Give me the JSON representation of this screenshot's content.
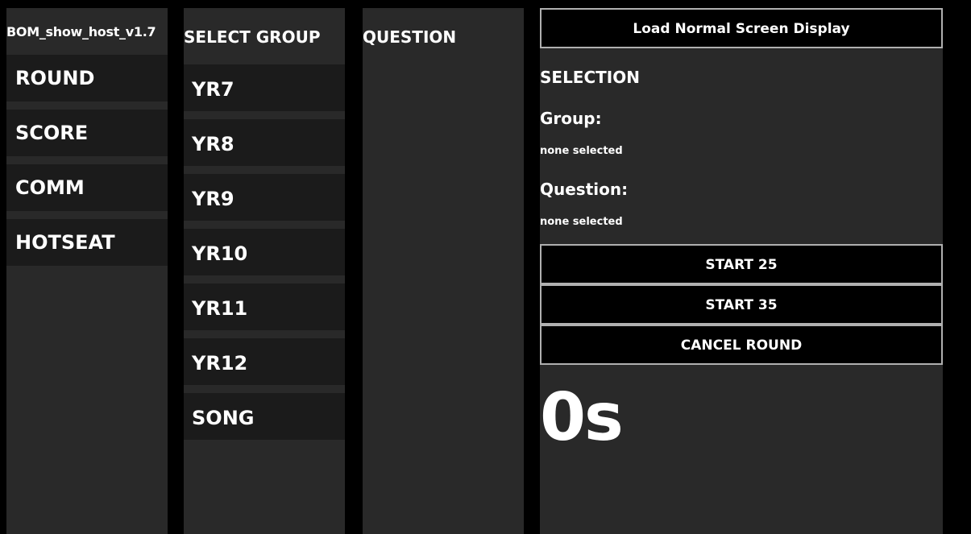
{
  "app": {
    "title": "BOM_show_host_v1.7"
  },
  "nav": {
    "items": [
      {
        "label": "ROUND"
      },
      {
        "label": "SCORE"
      },
      {
        "label": "COMM"
      },
      {
        "label": "HOTSEAT"
      }
    ]
  },
  "group_panel": {
    "heading": "SELECT GROUP",
    "items": [
      {
        "label": "YR7"
      },
      {
        "label": "YR8"
      },
      {
        "label": "YR9"
      },
      {
        "label": "YR10"
      },
      {
        "label": "YR11"
      },
      {
        "label": "YR12"
      },
      {
        "label": "SONG"
      }
    ]
  },
  "question_panel": {
    "heading": "QUESTION"
  },
  "control": {
    "load_display_label": "Load Normal Screen Display",
    "selection_heading": "SELECTION",
    "group_label": "Group:",
    "group_value": "none selected",
    "question_label": "Question:",
    "question_value": "none selected",
    "start25_label": "START 25",
    "start35_label": "START 35",
    "cancel_label": "CANCEL ROUND",
    "timer": "0s"
  },
  "colors": {
    "page_background": "#000000",
    "panel_background": "#292929",
    "item_background": "#1b1b1b",
    "button_background": "#000000",
    "button_border": "#b0b0b0",
    "text": "#ffffff"
  }
}
